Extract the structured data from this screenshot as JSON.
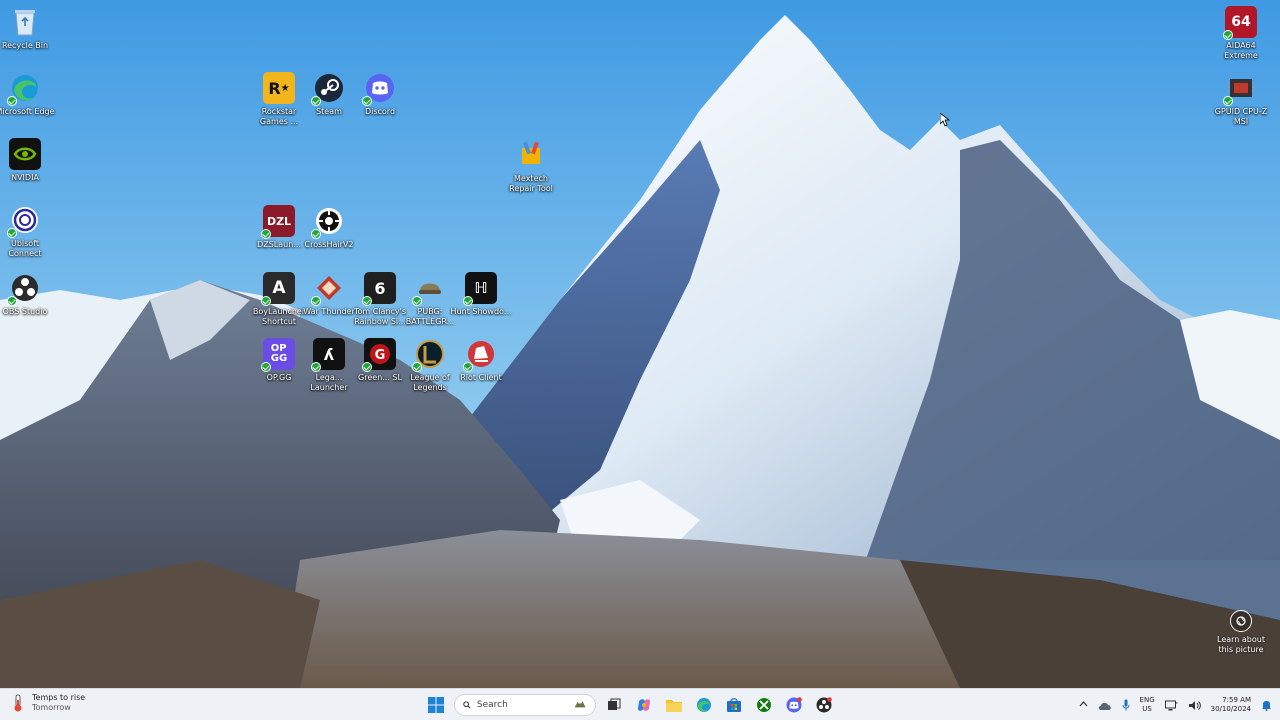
{
  "desktop": {
    "icons": [
      {
        "label": "Recycle Bin",
        "icon": "recycle-bin-icon",
        "color": "#cfe3f3"
      },
      {
        "label": "Microsoft Edge",
        "icon": "edge-icon",
        "color": "#1a9ad6"
      },
      {
        "label": "NVIDIA",
        "icon": "nvidia-icon",
        "color": "#111111"
      },
      {
        "label": "Ubisoft Connect",
        "icon": "ubisoft-icon",
        "color": "#ffffff"
      },
      {
        "label": "OBS Studio",
        "icon": "obs-icon",
        "color": "#2b2b2b"
      },
      {
        "label": "Rockstar Games ...",
        "icon": "rockstar-icon",
        "color": "#f2b51c"
      },
      {
        "label": "Steam",
        "icon": "steam-icon",
        "color": "#1b2838"
      },
      {
        "label": "Discord",
        "icon": "discord-icon",
        "color": "#5865f2"
      },
      {
        "label": "Mextech Repair Tool",
        "icon": "repair-tool-icon",
        "color": "#f0b400"
      },
      {
        "label": "DZSLaun...",
        "icon": "dzsl-icon",
        "color": "#8b1a2b"
      },
      {
        "label": "CrossHairV2",
        "icon": "crosshair-icon",
        "color": "#ffffff"
      },
      {
        "label": "BoyLauncher Shortcut",
        "icon": "launcher-icon",
        "color": "#2a2a2a"
      },
      {
        "label": "War Thunder",
        "icon": "war-thunder-icon",
        "color": "#c0392b"
      },
      {
        "label": "Tom Clancy's Rainbow Si...",
        "icon": "rainbow-six-icon",
        "color": "#1f1f1f"
      },
      {
        "label": "PUBG: BATTLEGR...",
        "icon": "pubg-icon",
        "color": "#8a7a55"
      },
      {
        "label": "Hunt Showdo...",
        "icon": "hunt-icon",
        "color": "#111111"
      },
      {
        "label": "OP.GG",
        "icon": "opgg-icon",
        "color": "#6b4de6"
      },
      {
        "label": "Lega... Launcher",
        "icon": "legacy-launcher-icon",
        "color": "#111111"
      },
      {
        "label": "Green... SL",
        "icon": "greenlight-icon",
        "color": "#c0141c"
      },
      {
        "label": "League of Legends",
        "icon": "league-icon",
        "color": "#c89b3c"
      },
      {
        "label": "Riot Client",
        "icon": "riot-client-icon",
        "color": "#d13639"
      },
      {
        "label": "AIDA64 Extreme",
        "icon": "aida64-icon",
        "color": "#b0182a"
      },
      {
        "label": "GPUID CPU-Z MSI",
        "icon": "cpuz-icon",
        "color": "#c0392b"
      }
    ],
    "learn_picture": "Learn about this picture"
  },
  "taskbar": {
    "weather": {
      "title": "Temps to rise",
      "subtitle": "Tomorrow"
    },
    "search_placeholder": "Search",
    "lang": {
      "top": "ENG",
      "bottom": "US"
    },
    "clock": {
      "time": "7:59 AM",
      "date": "30/10/2024"
    }
  }
}
